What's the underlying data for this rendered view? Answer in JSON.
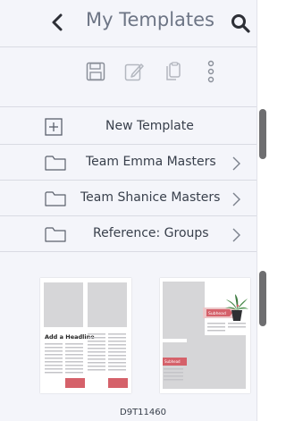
{
  "header": {
    "title": "My Templates",
    "back_icon": "chevron-left-icon",
    "search_icon": "search-icon"
  },
  "toolbar": {
    "icons": [
      "save-icon",
      "edit-icon",
      "copy-icon",
      "more-vertical-icon"
    ]
  },
  "list": {
    "new_template_label": "New Template",
    "folders": [
      {
        "label": "Team Emma Masters"
      },
      {
        "label": "Team Shanice Masters"
      },
      {
        "label": "Reference: Groups"
      }
    ]
  },
  "templates": [
    {
      "headline": "Add a Headline",
      "caption": "D9T11460"
    },
    {
      "headline": "Subhead",
      "subhead2": "Subhead"
    }
  ],
  "colors": {
    "background": "#f4f5fa",
    "text": "#39404c",
    "title": "#6d7585",
    "accent": "#d5616a",
    "scrollbar": "#6e6e70"
  }
}
